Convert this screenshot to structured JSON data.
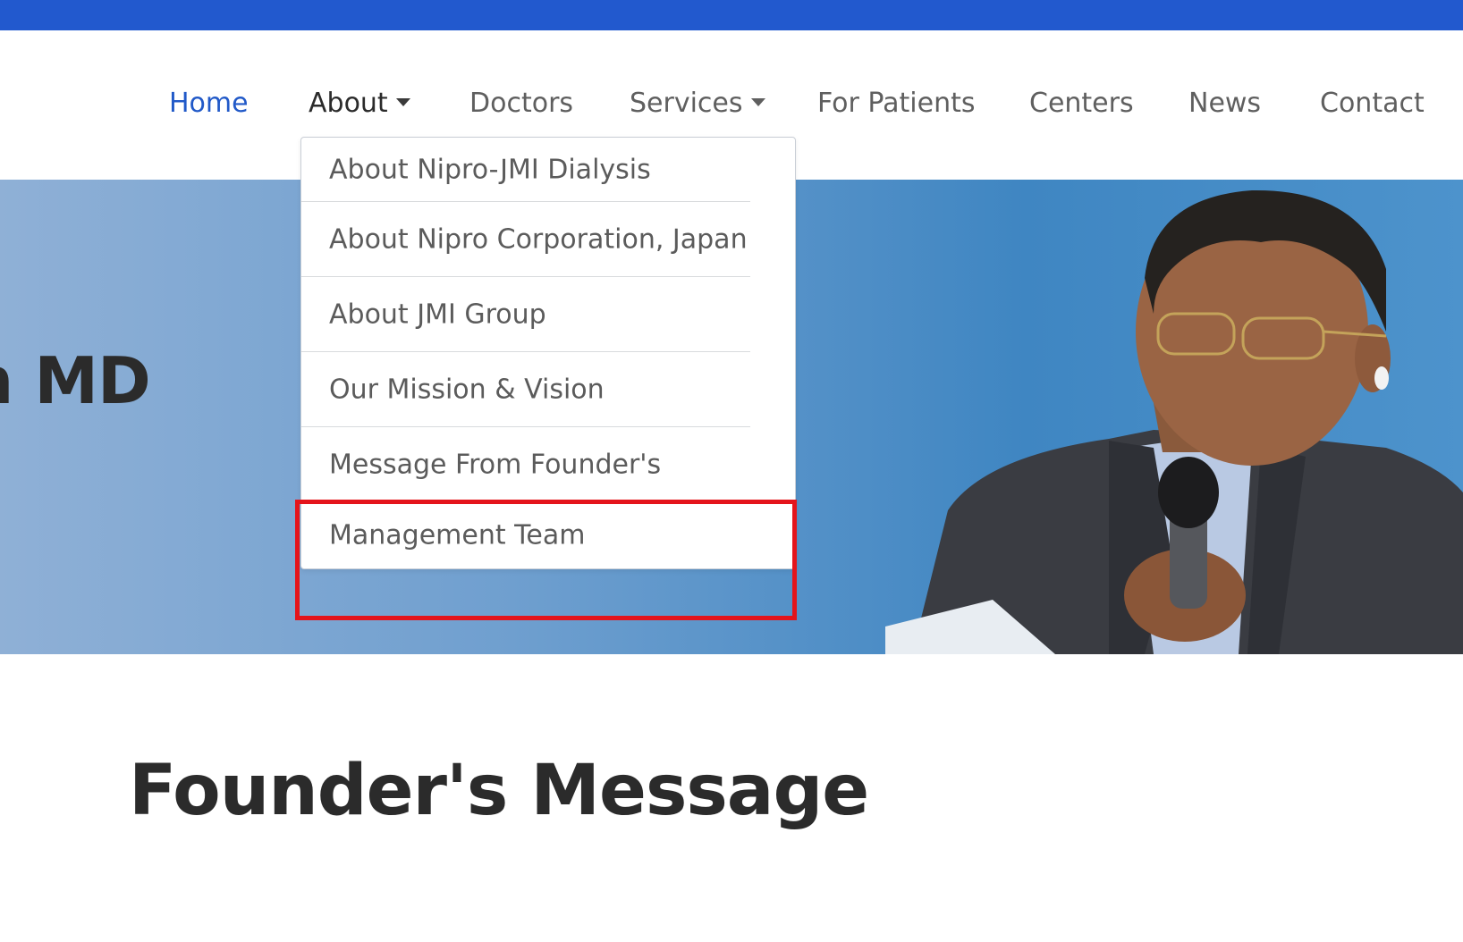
{
  "colors": {
    "top_bar": "#2259ce",
    "nav_active": "#2159c8",
    "nav_default": "#5f5f5f",
    "highlight": "#e4141b",
    "hero_left": "#8fb0d6",
    "hero_right": "#3f86c2"
  },
  "nav": {
    "items": [
      {
        "label": "Home",
        "active": true
      },
      {
        "label": "About",
        "has_dropdown": true,
        "open": true
      },
      {
        "label": "Doctors"
      },
      {
        "label": "Services",
        "has_dropdown": true
      },
      {
        "label": "For Patients"
      },
      {
        "label": "Centers"
      },
      {
        "label": "News"
      },
      {
        "label": "Contact"
      }
    ]
  },
  "about_menu": {
    "items": [
      "About Nipro-JMI Dialysis",
      "About Nipro Corporation, Japan",
      "About JMI Group",
      "Our Mission & Vision",
      "Message From Founder's",
      "Management Team"
    ],
    "highlighted": "Management Team"
  },
  "hero": {
    "partial_title": "n MD"
  },
  "section": {
    "title": "Founder's Message"
  }
}
